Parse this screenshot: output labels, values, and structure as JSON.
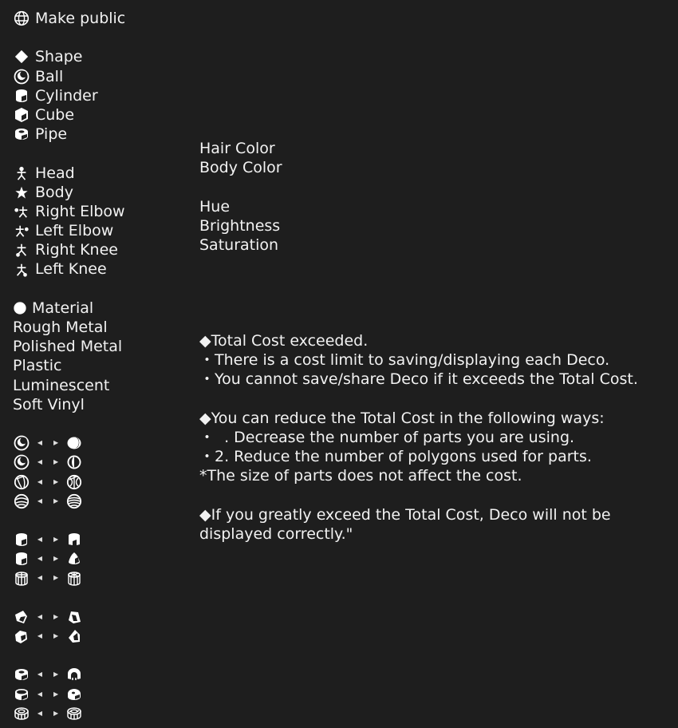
{
  "left": {
    "make_public": {
      "icon": "globe-icon",
      "label": "Make public"
    },
    "shape": {
      "header": {
        "icon": "diamond-icon",
        "label": "Shape"
      },
      "items": [
        {
          "icon": "ball-icon",
          "label": "Ball"
        },
        {
          "icon": "cylinder-icon",
          "label": "Cylinder"
        },
        {
          "icon": "cube-icon",
          "label": "Cube"
        },
        {
          "icon": "pipe-icon",
          "label": "Pipe"
        }
      ]
    },
    "body_parts": [
      {
        "icon": "head-figure-icon",
        "label": "Head"
      },
      {
        "icon": "body-figure-icon",
        "label": "Body"
      },
      {
        "icon": "right-elbow-figure-icon",
        "label": "Right Elbow"
      },
      {
        "icon": "left-elbow-figure-icon",
        "label": "Left Elbow"
      },
      {
        "icon": "right-knee-figure-icon",
        "label": "Right Knee"
      },
      {
        "icon": "left-knee-figure-icon",
        "label": "Left Knee"
      }
    ],
    "material": {
      "header": {
        "icon": "filled-circle-icon",
        "label": "Material"
      },
      "items": [
        "Rough Metal",
        "Polished Metal",
        "Plastic",
        "Luminescent",
        "Soft Vinyl"
      ]
    },
    "shape_swaps": {
      "ball": [
        "ball-variant-1",
        "ball-variant-2",
        "ball-variant-3",
        "ball-variant-4"
      ],
      "cylinder": [
        "cylinder-variant-1",
        "cylinder-variant-2",
        "cylinder-variant-3"
      ],
      "cube": [
        "cube-variant-1",
        "cube-variant-2"
      ],
      "pipe": [
        "pipe-variant-1",
        "pipe-variant-2",
        "pipe-variant-3"
      ]
    }
  },
  "mid": {
    "colors": [
      "Hair Color",
      "Body Color"
    ],
    "adjust": [
      "Hue",
      "Brightness",
      "Saturation"
    ]
  },
  "notice": {
    "diamond": "◆",
    "bullet": "・",
    "section1_title": "Total Cost exceeded.",
    "section1_lines": [
      "There is a cost limit to saving/displaying each Deco.",
      "You cannot save/share Deco if it exceeds the Total Cost."
    ],
    "section2_title": "You can reduce the Total Cost in the following ways:",
    "section2_lines": [
      "  . Decrease the number of parts you are using.",
      "2. Reduce the number of polygons used for parts."
    ],
    "section2_note": "*The size of parts does not affect the cost.",
    "section3_line1": "If you greatly exceed the Total Cost, Deco will not be",
    "section3_line2": "displayed correctly.\""
  }
}
